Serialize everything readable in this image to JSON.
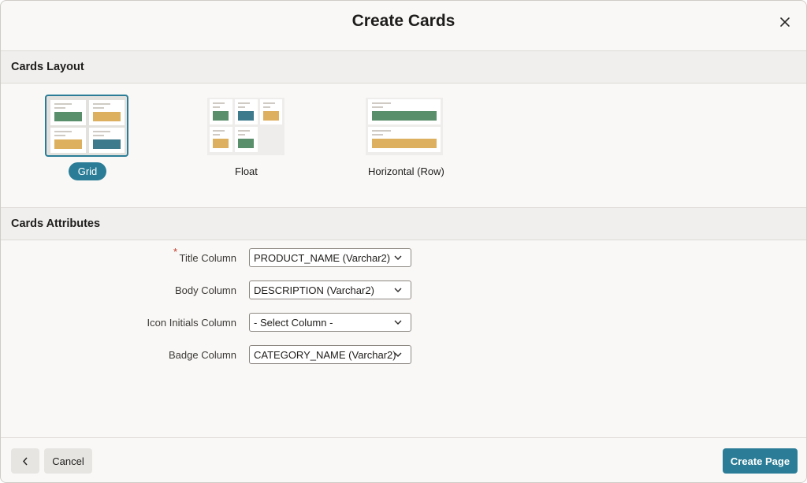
{
  "dialog": {
    "title": "Create Cards",
    "close_icon": "close-icon"
  },
  "layout_section": {
    "title": "Cards Layout",
    "options": [
      {
        "label": "Grid",
        "selected": true
      },
      {
        "label": "Float",
        "selected": false
      },
      {
        "label": "Horizontal (Row)",
        "selected": false
      }
    ]
  },
  "attributes_section": {
    "title": "Cards Attributes",
    "fields": [
      {
        "label": "Title Column",
        "required": true,
        "value": "PRODUCT_NAME (Varchar2)"
      },
      {
        "label": "Body Column",
        "required": false,
        "value": "DESCRIPTION (Varchar2)"
      },
      {
        "label": "Icon Initials Column",
        "required": false,
        "value": "- Select Column -"
      },
      {
        "label": "Badge Column",
        "required": false,
        "value": "CATEGORY_NAME (Varchar2)"
      }
    ]
  },
  "footer": {
    "back_icon": "chevron-left-icon",
    "cancel_label": "Cancel",
    "create_label": "Create Page"
  },
  "colors": {
    "accent": "#2b7d97",
    "thumb_green": "#5a8f6b",
    "thumb_gold": "#ddb05f",
    "thumb_teal": "#3d7a8c",
    "required": "#c0392b"
  }
}
